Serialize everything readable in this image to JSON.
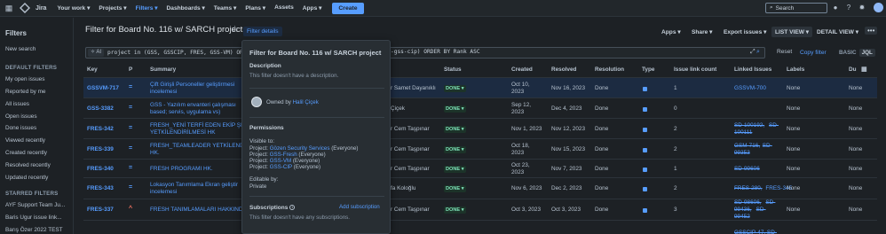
{
  "topbar": {
    "app_name": "Jira",
    "nav": [
      "Your work",
      "Projects",
      "Filters",
      "Dashboards",
      "Teams",
      "Plans",
      "Assets",
      "Apps"
    ],
    "nav_dropdowns": [
      true,
      true,
      true,
      true,
      true,
      true,
      false,
      true
    ],
    "create_label": "Create",
    "search_placeholder": "Search"
  },
  "sidebar": {
    "title": "Filters",
    "new_search": "New search",
    "default_heading": "DEFAULT FILTERS",
    "default_items": [
      "My open issues",
      "Reported by me",
      "All issues",
      "Open issues",
      "Done issues",
      "Viewed recently",
      "Created recently",
      "Resolved recently",
      "Updated recently"
    ],
    "starred_heading": "STARRED FILTERS",
    "starred_items": [
      "AYF Support Team Ju...",
      "Baris Ugur issue link...",
      "Barış Özer 2022 TEST"
    ]
  },
  "header": {
    "title": "Filter for Board No. 116 w/ SARCH project",
    "filter_details": "Filter details",
    "apps": "Apps",
    "share": "Share",
    "export": "Export issues",
    "list_view": "LIST VIEW",
    "detail_view": "DETAIL VIEW",
    "more": "•••"
  },
  "jql": {
    "ai_label": "AI",
    "query_start": "project in (GSS, GSSCIP, FRES, GSS-VM) OR",
    "query_end": "-gss-cip) ORDER BY Rank ASC",
    "reset": "Reset",
    "copy_filter": "Copy filter",
    "basic": "BASIC",
    "jql": "JQL"
  },
  "columns": {
    "key": "Key",
    "p": "P",
    "summary": "Summary",
    "status": "Status",
    "created": "Created",
    "resolved": "Resolved",
    "resolution": "Resolution",
    "type": "Type",
    "link_count": "Issue link count",
    "linked": "Linked Issues",
    "labels": "Labels",
    "due": "Du"
  },
  "rows": [
    {
      "key": "GSSVM-717",
      "p": "=",
      "summary1": "Çift Girişli Personeller geliştirmesi",
      "summary2": "incelemesi",
      "assignee": "r Samet Dayanıklı",
      "status": "DONE",
      "created1": "Oct 10,",
      "created2": "2023",
      "resolved": "Nov 16, 2023",
      "resolution": "Done",
      "count": "1",
      "linked": [
        "GSSVM-700"
      ],
      "linked_strike": [
        false
      ],
      "labels": "None",
      "due": "None"
    },
    {
      "key": "GSS-3382",
      "p": "=",
      "summary1": "GSS - Yazılım envanteri çalışması",
      "summary2": "based; servis, uygulama vs)",
      "assignee": "Çiçek",
      "status": "DONE",
      "created1": "Sep 12,",
      "created2": "2023",
      "resolved": "Dec 4, 2023",
      "resolution": "Done",
      "count": "0",
      "linked": [],
      "linked_strike": [],
      "labels": "None",
      "due": "None"
    },
    {
      "key": "FRES-342",
      "p": "=",
      "summary1": "FRESH_YENİ TERFİ EDEN EKİP ŞE",
      "summary2": "YETKİLENDİRİLMESİ HK",
      "assignee": "r Cem Taşpınar",
      "status": "DONE",
      "created1": "Nov 1, 2023",
      "created2": "",
      "resolved": "Nov 12, 2023",
      "resolution": "Done",
      "count": "2",
      "linked": [
        "SD-100192,",
        "SD-",
        "100111"
      ],
      "linked_strike": [
        true,
        true,
        true
      ],
      "labels": "None",
      "due": "None"
    },
    {
      "key": "FRES-339",
      "p": "=",
      "summary1": "FRESH_TEAMLEADER YETKİLEND",
      "summary2": "HK.",
      "assignee": "r Cem Taşpınar",
      "status": "DONE",
      "created1": "Oct 18,",
      "created2": "2023",
      "resolved": "Nov 15, 2023",
      "resolution": "Done",
      "count": "2",
      "linked": [
        "GSM-716,",
        "SD-",
        "99353"
      ],
      "linked_strike": [
        true,
        true,
        true
      ],
      "labels": "None",
      "due": "None"
    },
    {
      "key": "FRES-340",
      "p": "=",
      "summary1": "FRESH PROGRAMI HK.",
      "summary2": "",
      "assignee": "r Cem Taşpınar",
      "status": "DONE",
      "created1": "Oct 23,",
      "created2": "2023",
      "resolved": "Nov 7, 2023",
      "resolution": "Done",
      "count": "1",
      "linked": [
        "SD-99606"
      ],
      "linked_strike": [
        true
      ],
      "labels": "None",
      "due": "None"
    },
    {
      "key": "FRES-343",
      "p": "=",
      "summary1": "Lokasyon Tanımlama Ekran geliştir",
      "summary2": "incelemesi",
      "assignee": "fa Koloğlu",
      "status": "DONE",
      "created1": "Nov 6, 2023",
      "created2": "",
      "resolved": "Dec 2, 2023",
      "resolution": "Done",
      "count": "2",
      "linked": [
        "FRES-280,",
        "FRES-345"
      ],
      "linked_strike": [
        true,
        false
      ],
      "labels": "None",
      "due": "None"
    },
    {
      "key": "FRES-337",
      "p": "^",
      "summary1": "FRESH TANIMLAMALARI HAKKIND",
      "summary2": "",
      "assignee": "r Cem Taşpınar",
      "status": "DONE",
      "created1": "Oct 3, 2023",
      "created2": "",
      "resolved": "Oct 3, 2023",
      "resolution": "Done",
      "count": "3",
      "linked": [
        "SD-98606,",
        "SD-",
        "99436,",
        "SD-",
        "99452"
      ],
      "linked_strike": [
        true,
        true,
        true,
        true,
        true
      ],
      "labels": "None",
      "due": "None"
    }
  ],
  "last_row_linked": "GSSCIP-47, SD-",
  "popup": {
    "title": "Filter for Board No. 116 w/ SARCH project",
    "desc_heading": "Description",
    "desc_text": "This filter doesn't have a description.",
    "owned_by": "Owned by",
    "owner": "Halil Çiçek",
    "perm_heading": "Permissions",
    "visible_heading": "Visible to:",
    "visible": [
      {
        "prefix": "Project:",
        "name": "Gözen Security Services",
        "role": "(Everyone)"
      },
      {
        "prefix": "Project:",
        "name": "GSS-Fresh",
        "role": "(Everyone)"
      },
      {
        "prefix": "Project:",
        "name": "GSS-VM",
        "role": "(Everyone)"
      },
      {
        "prefix": "Project:",
        "name": "GSS-CIP",
        "role": "(Everyone)"
      }
    ],
    "editable_heading": "Editable by:",
    "editable_value": "Private",
    "subs_heading": "Subscriptions",
    "add_sub": "Add subscription",
    "subs_text": "This filter doesn't have any subscriptions."
  },
  "colors": {
    "accent": "#579dff",
    "done": "#7ee2b8",
    "bg": "#1d2125"
  }
}
